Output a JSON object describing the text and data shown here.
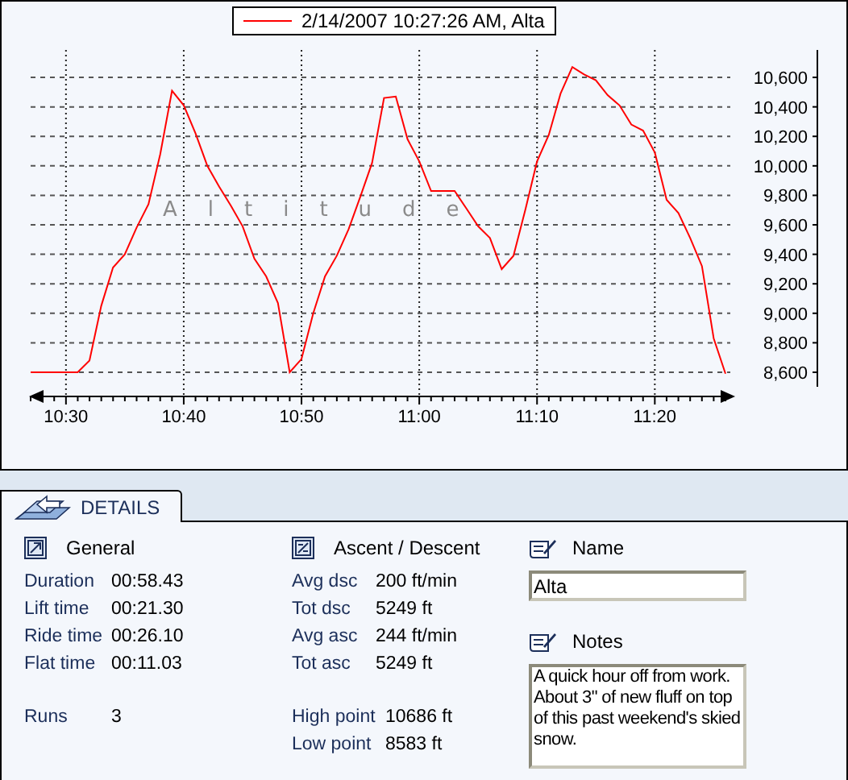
{
  "chart": {
    "chart_data": {
      "type": "line",
      "grid": true,
      "categories": [
        null,
        null,
        null,
        "10:30",
        null,
        null,
        null,
        null,
        null,
        null,
        null,
        null,
        null,
        "10:40",
        null,
        null,
        null,
        null,
        null,
        null,
        null,
        null,
        null,
        "10:50",
        null,
        null,
        null,
        null,
        null,
        null,
        null,
        null,
        null,
        "11:00",
        null,
        null,
        null,
        null,
        null,
        null,
        null,
        null,
        null,
        "11:10",
        null,
        null,
        null,
        null,
        null,
        null,
        null,
        null,
        null,
        "11:20",
        null,
        null,
        null,
        null,
        null,
        null
      ],
      "series": [
        {
          "name": "2/14/2007 10:27:26 AM, Alta",
          "color": "#ff0000",
          "values": [
            8600,
            8600,
            8600,
            8600,
            8600,
            8680,
            9050,
            9310,
            9400,
            9580,
            9740,
            10080,
            10510,
            10410,
            10220,
            10000,
            9860,
            9730,
            9590,
            9370,
            9250,
            9070,
            8600,
            8690,
            9000,
            9250,
            9390,
            9570,
            9790,
            10020,
            10460,
            10470,
            10180,
            10030,
            9830,
            9830,
            9830,
            9710,
            9590,
            9510,
            9300,
            9390,
            9700,
            10030,
            10210,
            10490,
            10670,
            10620,
            10580,
            10480,
            10410,
            10280,
            10240,
            10090,
            9770,
            9680,
            9510,
            9320,
            8830,
            8590
          ]
        }
      ],
      "ylim": [
        8436,
        10786
      ],
      "yticks": [
        {
          "value": 8600,
          "label": "8,600"
        },
        {
          "value": 8800,
          "label": "8,800"
        },
        {
          "value": 9000,
          "label": "9,000"
        },
        {
          "value": 9200,
          "label": "9,200"
        },
        {
          "value": 9400,
          "label": "9,400"
        },
        {
          "value": 9600,
          "label": "9,600"
        },
        {
          "value": 9800,
          "label": "9,800"
        },
        {
          "value": 10000,
          "label": "10,000"
        },
        {
          "value": 10200,
          "label": "10,200"
        },
        {
          "value": 10400,
          "label": "10,400"
        },
        {
          "value": 10600,
          "label": "10,600"
        }
      ],
      "annotations": [
        {
          "text": "Altitude"
        }
      ]
    }
  },
  "details_tab": {
    "label": "DETAILS",
    "selected": true
  },
  "general": {
    "title": "General",
    "rows": [
      {
        "label": "Duration",
        "value": "00:58.43"
      },
      {
        "label": "Lift time",
        "value": "00:21.30"
      },
      {
        "label": "Ride time",
        "value": "00:26.10"
      },
      {
        "label": "Flat time",
        "value": "00:11.03"
      }
    ],
    "extra_rows": [
      {
        "label": "Runs",
        "value": "3"
      }
    ]
  },
  "ascent_descent": {
    "title": "Ascent / Descent",
    "rows": [
      {
        "label": "Avg dsc",
        "value": "200 ft/min"
      },
      {
        "label": "Tot dsc",
        "value": "5249 ft"
      },
      {
        "label": "Avg asc",
        "value": "244 ft/min"
      },
      {
        "label": "Tot asc",
        "value": "5249 ft"
      }
    ],
    "extra_rows": [
      {
        "label": "High point",
        "value": "10686 ft"
      },
      {
        "label": "Low point",
        "value": "8583 ft"
      }
    ]
  },
  "name": {
    "title": "Name",
    "value": "Alta"
  },
  "notes": {
    "title": "Notes",
    "value": "A quick hour off from work. About 3\" of new fluff on top of this past weekend's skied snow."
  }
}
